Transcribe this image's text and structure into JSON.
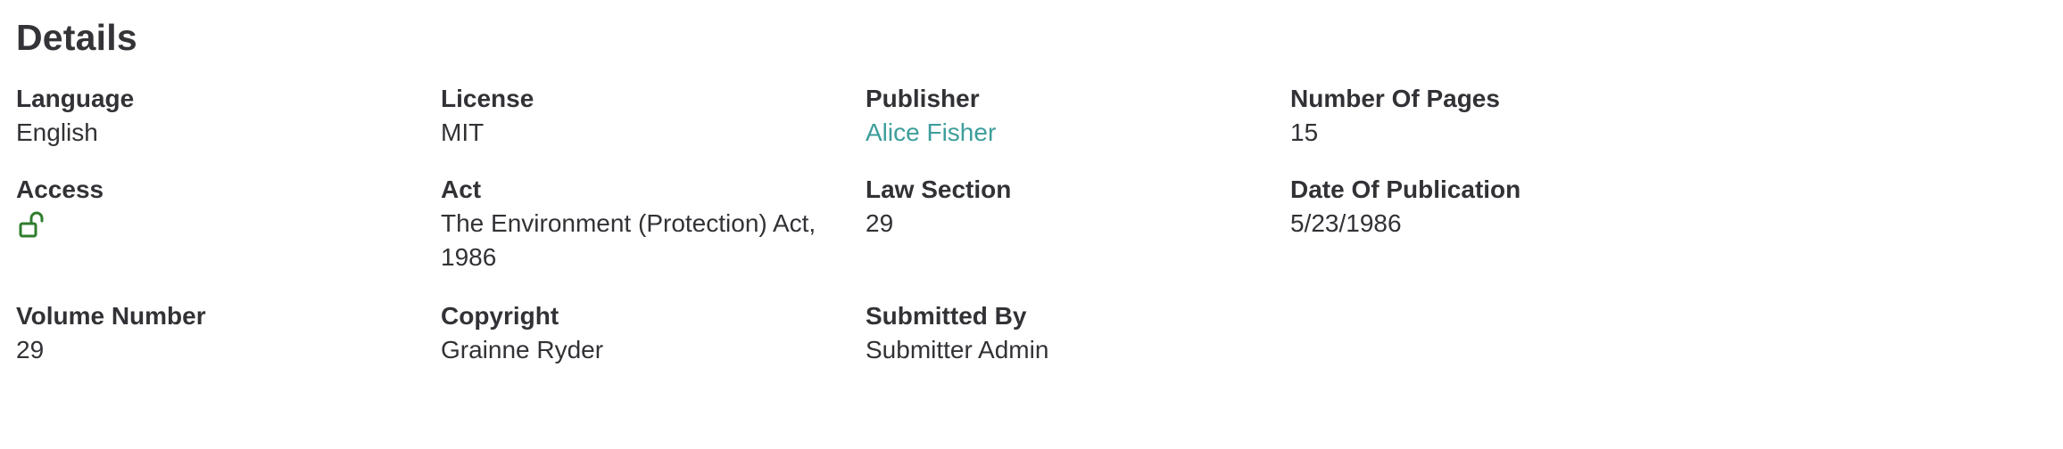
{
  "details": {
    "title": "Details",
    "fields": {
      "language": {
        "label": "Language",
        "value": "English"
      },
      "license": {
        "label": "License",
        "value": "MIT"
      },
      "publisher": {
        "label": "Publisher",
        "value": "Alice Fisher"
      },
      "number_of_pages": {
        "label": "Number Of Pages",
        "value": "15"
      },
      "access": {
        "label": "Access",
        "icon": "unlocked-padlock-icon",
        "icon_color": "#2e7d2e"
      },
      "act": {
        "label": "Act",
        "value": "The Environment (Protection) Act, 1986"
      },
      "law_section": {
        "label": "Law Section",
        "value": "29"
      },
      "date_of_publication": {
        "label": "Date Of Publication",
        "value": "5/23/1986"
      },
      "volume_number": {
        "label": "Volume Number",
        "value": "29"
      },
      "copyright": {
        "label": "Copyright",
        "value": "Grainne Ryder"
      },
      "submitted_by": {
        "label": "Submitted By",
        "value": "Submitter Admin"
      }
    }
  },
  "colors": {
    "text": "#323236",
    "link": "#3d9e9b",
    "access_icon": "#2e7d2e"
  }
}
